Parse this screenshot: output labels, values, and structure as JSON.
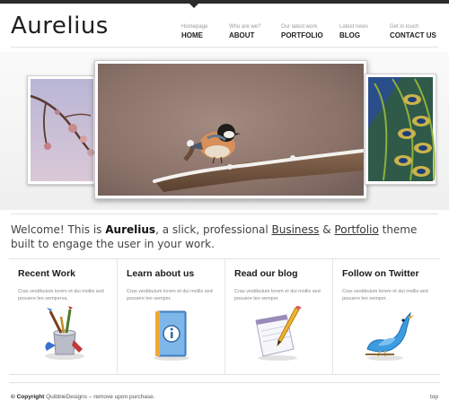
{
  "logo": "Aurelius",
  "nav": [
    {
      "sub": "Homepage",
      "label": "HOME"
    },
    {
      "sub": "Who are we?",
      "label": "ABOUT"
    },
    {
      "sub": "Our latest work",
      "label": "PORTFOLIO"
    },
    {
      "sub": "Latest news",
      "label": "BLOG"
    },
    {
      "sub": "Get in touch",
      "label": "CONTACT US"
    }
  ],
  "welcome": {
    "part1": "Welcome! This is ",
    "brand": "Aurelius",
    "part2": ", a slick, professional ",
    "link1": "Business",
    "amp": " & ",
    "link2": "Portfolio",
    "part3": " theme built to engage the user in your work."
  },
  "features": [
    {
      "title": "Recent Work",
      "text": "Cras vestibulum lorem et dui mollis sed posuere leo semperva.",
      "icon": "paint-brushes-icon"
    },
    {
      "title": "Learn about us",
      "text": "Cras vestibulum lorem et dui mollis sed posuere leo semper.",
      "icon": "info-book-icon"
    },
    {
      "title": "Read our blog",
      "text": "Cras vestibulum lorem et dui mollis sed posuere leo semper.",
      "icon": "notepad-pencil-icon"
    },
    {
      "title": "Follow on Twitter",
      "text": "Cras vestibulum lorem et dui mollis sed posuere leo semper.",
      "icon": "twitter-bird-icon"
    }
  ],
  "footer": {
    "copyright_label": "© Copyright",
    "copyright_text": " QuibbleDesigns – remove upon purchase.",
    "top_link": "top"
  },
  "colors": {
    "text_dark": "#1e1e1e",
    "text_muted": "#888888",
    "topbar": "#2b2b2b"
  }
}
